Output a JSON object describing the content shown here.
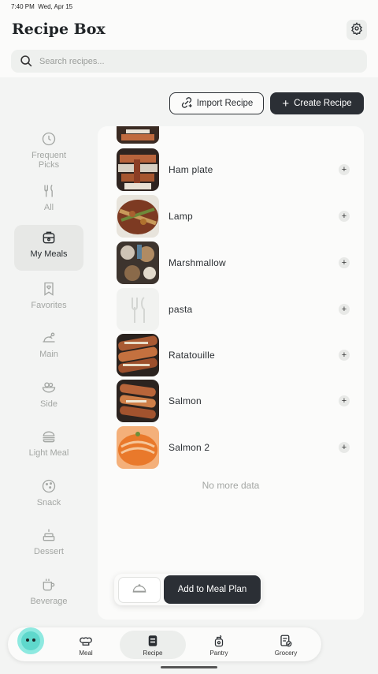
{
  "status_bar": {
    "time": "7:40 PM",
    "date": "Wed, Apr 15"
  },
  "app": {
    "title": "Recipe Box",
    "settings_icon": "gear-icon"
  },
  "search": {
    "placeholder": "Search recipes..."
  },
  "actions": {
    "import_label": "Import Recipe",
    "create_label": "Create Recipe"
  },
  "sidebar": {
    "items": [
      {
        "label": "Frequent Picks",
        "icon": "clock-icon",
        "active": false
      },
      {
        "label": "All",
        "icon": "fork-knife-icon",
        "active": false
      },
      {
        "label": "My Meals",
        "icon": "lunchbox-icon",
        "active": true
      },
      {
        "label": "Favorites",
        "icon": "heart-bookmark-icon",
        "active": false
      },
      {
        "label": "Main",
        "icon": "roast-chicken-icon",
        "active": false
      },
      {
        "label": "Side",
        "icon": "salad-bowl-icon",
        "active": false
      },
      {
        "label": "Light Meal",
        "icon": "burger-icon",
        "active": false
      },
      {
        "label": "Snack",
        "icon": "cookie-icon",
        "active": false
      },
      {
        "label": "Dessert",
        "icon": "cake-icon",
        "active": false
      },
      {
        "label": "Beverage",
        "icon": "mug-icon",
        "active": false
      }
    ]
  },
  "recipes": [
    {
      "name": "Ham plate",
      "thumb": "photo"
    },
    {
      "name": "Lamp",
      "thumb": "photo"
    },
    {
      "name": "Marshmallow",
      "thumb": "photo"
    },
    {
      "name": "pasta",
      "thumb": "placeholder"
    },
    {
      "name": "Ratatouille",
      "thumb": "photo"
    },
    {
      "name": "Salmon",
      "thumb": "photo"
    },
    {
      "name": "Salmon 2",
      "thumb": "photo-orange"
    }
  ],
  "list_footer": "No more data",
  "meal_plan": {
    "label": "Add to Meal Plan",
    "icon": "cloche-icon"
  },
  "bottom_nav": {
    "items": [
      {
        "label": "Meal",
        "icon": "chef-hat-icon",
        "active": false
      },
      {
        "label": "Recipe",
        "icon": "recipe-book-icon",
        "active": true
      },
      {
        "label": "Pantry",
        "icon": "pantry-jar-icon",
        "active": false
      },
      {
        "label": "Grocery",
        "icon": "grocery-list-icon",
        "active": false
      }
    ]
  },
  "colors": {
    "accent_dark": "#2b2f35",
    "background": "#f3f4f3",
    "panel": "#fbfbfa",
    "muted": "#a3a6a3"
  }
}
